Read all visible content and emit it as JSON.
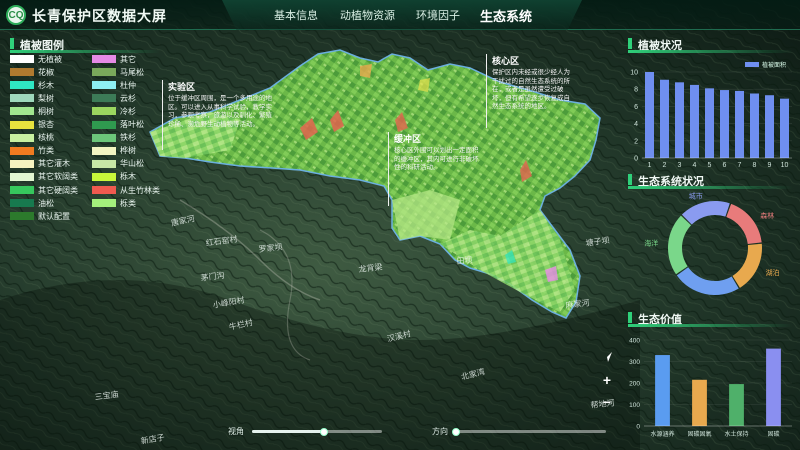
{
  "app": {
    "logo_text": "CQ",
    "title": "长青保护区数据大屏"
  },
  "nav": [
    {
      "label": "基本信息",
      "active": false
    },
    {
      "label": "动植物资源",
      "active": false
    },
    {
      "label": "环境因子",
      "active": false
    },
    {
      "label": "生态系统",
      "active": true
    }
  ],
  "legend": {
    "title": "植被图例",
    "items": [
      {
        "label": "无植被",
        "color": "#ffffff"
      },
      {
        "label": "其它",
        "color": "#e58ae5"
      },
      {
        "label": "花椒",
        "color": "#b07a2f"
      },
      {
        "label": "马尾松",
        "color": "#7aa95b"
      },
      {
        "label": "杉木",
        "color": "#2fe7c3"
      },
      {
        "label": "杜仲",
        "color": "#8ef0f3"
      },
      {
        "label": "梨树",
        "color": "#9ed9bc"
      },
      {
        "label": "云杉",
        "color": "#3c7b57"
      },
      {
        "label": "桐树",
        "color": "#a1e68f"
      },
      {
        "label": "冷杉",
        "color": "#9bd65f"
      },
      {
        "label": "银杏",
        "color": "#e7e23e"
      },
      {
        "label": "落叶松",
        "color": "#2f9a4f"
      },
      {
        "label": "核桃",
        "color": "#c8f0a0"
      },
      {
        "label": "铁杉",
        "color": "#6cc77a"
      },
      {
        "label": "竹类",
        "color": "#f07b20"
      },
      {
        "label": "桦树",
        "color": "#f3f5c2"
      },
      {
        "label": "其它灌木",
        "color": "#f5f2c0"
      },
      {
        "label": "华山松",
        "color": "#c7e7a6"
      },
      {
        "label": "其它软阔类",
        "color": "#e3f7d2"
      },
      {
        "label": "栎木",
        "color": "#c9f73a"
      },
      {
        "label": "其它硬阔类",
        "color": "#36c85d"
      },
      {
        "label": "从生竹林类",
        "color": "#f05a4f"
      },
      {
        "label": "油松",
        "color": "#177a4e"
      },
      {
        "label": "栎类",
        "color": "#a4f07c"
      },
      {
        "label": "默认配置",
        "color": "#2c7a2c"
      }
    ]
  },
  "annotations": [
    {
      "title": "实验区",
      "text": "位于缓冲区周围，是一个多用途的地区。可以进入从事科学试验，教学实习，参观考察，旅游以及驯化、繁殖珍稀、濒危野生动植物等活动。"
    },
    {
      "title": "核心区",
      "text": "保护区内未经或很少经人为干扰过的自然生态系统的所在，或者是虽然遭受过破坏，但有希望逐步恢复成自然生态系统的地区。"
    },
    {
      "title": "缓冲区",
      "text": "核心区外围可以划出一定面积的缓冲区，其内可进行非破坏性的科研活动。"
    }
  ],
  "map_places": [
    "唐家河",
    "红石窑村",
    "罗家坝",
    "茅门沟",
    "小峰阳村",
    "牛栏村",
    "三宝庙",
    "田坝",
    "汉溪村",
    "龙背梁",
    "北家湾",
    "新店子",
    "麻家河",
    "塘子坝",
    "帮地河"
  ],
  "vegetation_chart": {
    "title": "植被状况",
    "legend": "植被面积",
    "chart_data": {
      "type": "bar",
      "categories": [
        "1",
        "2",
        "3",
        "4",
        "5",
        "6",
        "7",
        "8",
        "9",
        "10"
      ],
      "series": [
        {
          "name": "植被面积",
          "values": [
            10,
            9.1,
            8.8,
            8.5,
            8.1,
            7.9,
            7.8,
            7.5,
            7.3,
            6.9
          ]
        }
      ],
      "ylim": [
        0,
        10
      ],
      "yticks": [
        0,
        2,
        4,
        6,
        8,
        10
      ],
      "color": "#6f8ff0"
    }
  },
  "eco_chart": {
    "title": "生态系统状况",
    "chart_data": {
      "type": "pie",
      "labels": [
        "森林",
        "湖泊",
        "草地",
        "海洋",
        "城市"
      ],
      "values": [
        18,
        18,
        24,
        22,
        18
      ],
      "colors": [
        "#e87b7b",
        "#e8a94e",
        "#6f9ff0",
        "#7ad78a",
        "#8a9bf0"
      ],
      "visible_labels": [
        "森林",
        "湖泊",
        "海洋",
        "城市"
      ]
    }
  },
  "value_chart": {
    "title": "生态价值",
    "chart_data": {
      "type": "bar",
      "categories": [
        "水源涵养",
        "固碳固氧",
        "水土保持",
        "固碳"
      ],
      "values": [
        330,
        215,
        195,
        360
      ],
      "colors": [
        "#5a9cf0",
        "#e8a94e",
        "#4fb06a",
        "#8a8ff0"
      ],
      "ylim": [
        0,
        400
      ],
      "yticks": [
        0,
        100,
        200,
        300,
        400
      ]
    }
  },
  "controls": {
    "view_angle_label": "视角",
    "view_angle_value": 0.55,
    "direction_label": "方向",
    "direction_value": 0.0,
    "zoom_in": "+",
    "zoom_out": "−"
  }
}
